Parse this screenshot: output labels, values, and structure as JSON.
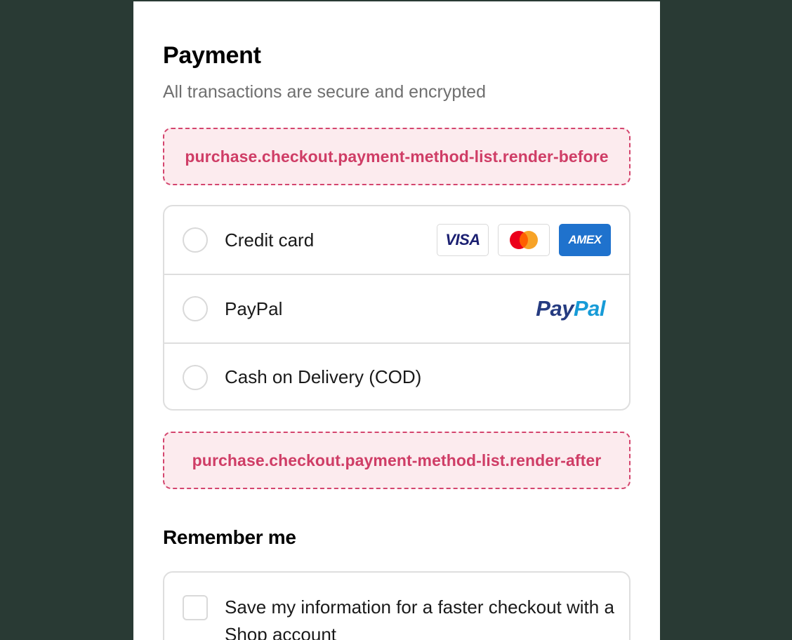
{
  "payment": {
    "title": "Payment",
    "subtitle": "All transactions are secure and encrypted",
    "slot_before": "purchase.checkout.payment-method-list.render-before",
    "slot_after": "purchase.checkout.payment-method-list.render-after",
    "methods": [
      {
        "label": "Credit card",
        "selected": false,
        "icons": [
          {
            "name": "visa-icon",
            "text": "VISA"
          },
          {
            "name": "mastercard-icon"
          },
          {
            "name": "amex-icon",
            "text": "AMEX"
          }
        ]
      },
      {
        "label": "PayPal",
        "selected": false,
        "logo": {
          "name": "paypal-logo",
          "part1": "Pay",
          "part2": "Pal"
        }
      },
      {
        "label": "Cash on Delivery (COD)",
        "selected": false
      }
    ]
  },
  "remember": {
    "title": "Remember me",
    "checkbox_label": "Save my information for a faster checkout with a Shop account",
    "checked": false
  },
  "colors": {
    "background": "#293a34",
    "slot_border": "#d4456e",
    "slot_fill": "#fcebee",
    "slot_text": "#cf3d66",
    "visa_blue": "#1a1f71",
    "amex_blue": "#1f72cd",
    "paypal_dark": "#253b80",
    "paypal_light": "#179bd7",
    "mastercard_red": "#eb001b",
    "mastercard_orange": "#f79e1b"
  }
}
